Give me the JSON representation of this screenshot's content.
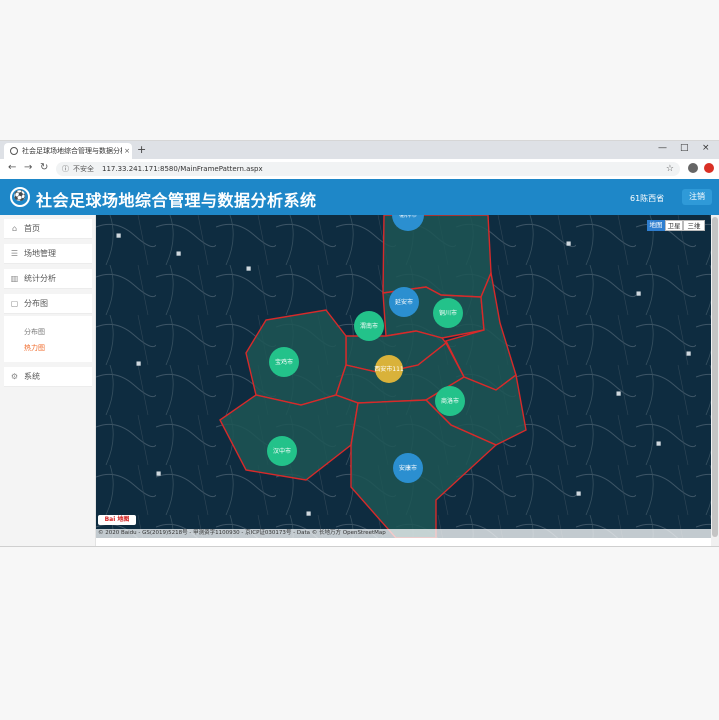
{
  "browser": {
    "tab_title": "社会足球场地综合管理与数据分析系统",
    "tab_close": "×",
    "new_tab": "+",
    "window_controls": [
      "—",
      "□",
      "×"
    ],
    "nav_icons": [
      "arrow-left-icon",
      "arrow-right-icon",
      "reload-icon"
    ],
    "security_label": "不安全",
    "url": "117.33.241.171:8580/MainFramePattern.aspx"
  },
  "app": {
    "title": "社会足球场地综合管理与数据分析系统",
    "user": "61陈西省",
    "logout_label": "注销",
    "accent": "#1e87c8"
  },
  "sidebar": {
    "items": [
      {
        "label": "首页",
        "icon": "home-icon"
      },
      {
        "label": "场地管理",
        "icon": "list-icon"
      },
      {
        "label": "统计分析",
        "icon": "bar-chart-icon"
      },
      {
        "label": "分布图",
        "icon": "map-icon"
      },
      {
        "label": "系统",
        "icon": "gear-icon"
      }
    ],
    "sub_items": [
      {
        "label": "分布图",
        "active": false
      },
      {
        "label": "热力图",
        "active": true
      }
    ]
  },
  "map": {
    "toggles": [
      "地图",
      "卫星",
      "三维"
    ],
    "clusters": [
      {
        "label": "榆林市",
        "color": "#2b8fd0"
      },
      {
        "label": "延安市",
        "color": "#2b8fd0"
      },
      {
        "label": "铜川市",
        "color": "#23c28a"
      },
      {
        "label": "渭南市",
        "color": "#23c28a"
      },
      {
        "label": "宝鸡市",
        "color": "#23c28a"
      },
      {
        "label": "西安市111",
        "color": "#d9b23a"
      },
      {
        "label": "商洛市",
        "color": "#23c28a"
      },
      {
        "label": "汉中市",
        "color": "#23c28a"
      },
      {
        "label": "安康市",
        "color": "#2b8fd0"
      }
    ],
    "logo": "Bai 地图",
    "copyright": "© 2020 Baidu - GS(2019)5218号 - 甲测资字1100930 - 京ICP证030173号 - Data © 长地万方 OpenStreetMap"
  }
}
